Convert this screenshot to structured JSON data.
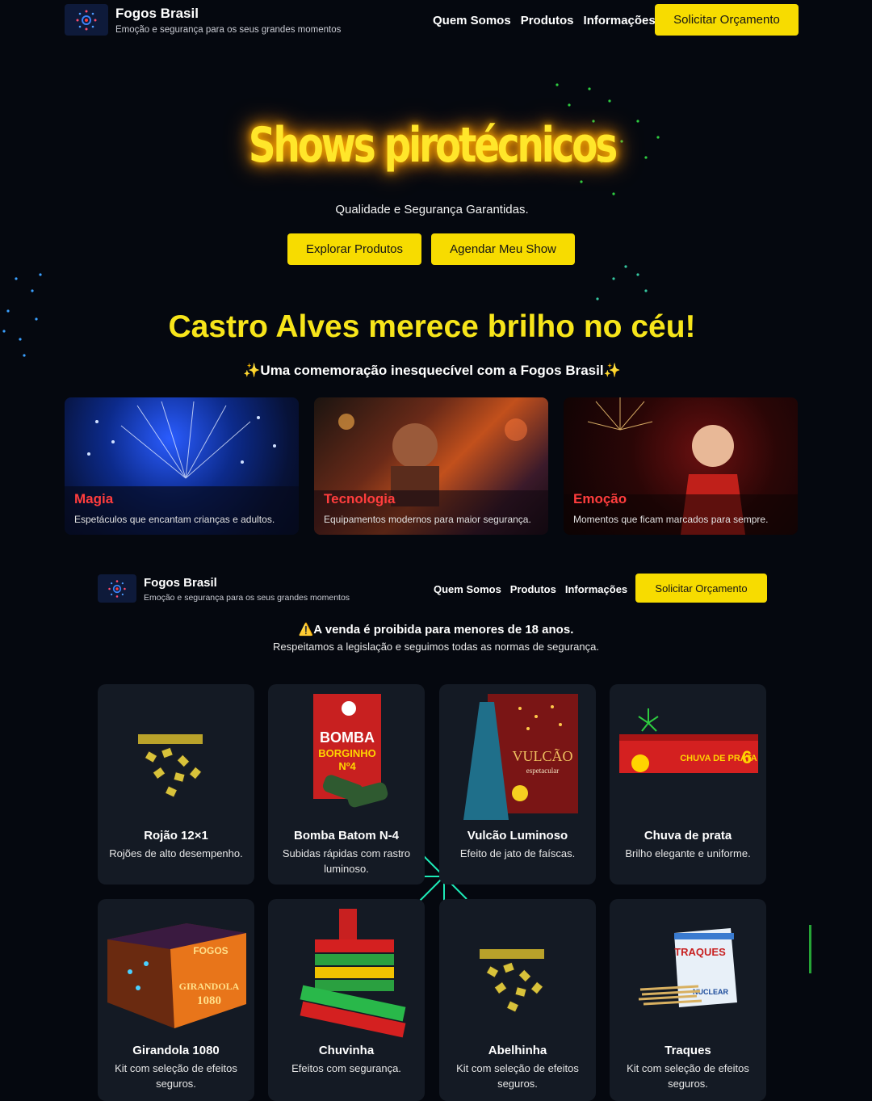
{
  "brand": {
    "name": "Fogos Brasil",
    "tagline": "Emoção e segurança para os seus grandes momentos"
  },
  "nav": {
    "items": [
      "Quem Somos",
      "Produtos",
      "Informações"
    ],
    "cta": "Solicitar Orçamento"
  },
  "hero": {
    "title": "Shows pirotécnicos",
    "subtitle": "Qualidade e Segurança Garantidas.",
    "buttons": [
      "Explorar Produtos",
      "Agendar Meu Show"
    ]
  },
  "city": {
    "title": "Castro Alves merece brilho no céu!",
    "subtitle": "✨Uma comemoração inesquecível com a Fogos Brasil✨"
  },
  "features": [
    {
      "title": "Magia",
      "description": "Espetáculos que encantam crianças e adultos."
    },
    {
      "title": "Tecnologia",
      "description": "Equipamentos modernos para maior segurança."
    },
    {
      "title": "Emoção",
      "description": "Momentos que ficam marcados para sempre."
    }
  ],
  "warning": {
    "title": "⚠️A venda é proibida para menores de 18 anos.",
    "subtitle": "Respeitamos a legislação e seguimos todas as normas de segurança."
  },
  "products": [
    {
      "name": "Rojão 12×1",
      "description": "Rojões de alto desempenho."
    },
    {
      "name": "Bomba Batom N-4",
      "description": "Subidas rápidas com rastro luminoso.",
      "image_text": [
        "BOMBA",
        "BORGINHO",
        "Nº4"
      ]
    },
    {
      "name": "Vulcão Luminoso",
      "description": "Efeito de jato de faíscas.",
      "image_text": [
        "VULCÃO",
        "espetacular"
      ]
    },
    {
      "name": "Chuva de prata",
      "description": "Brilho elegante e uniforme.",
      "image_text": [
        "CHUVA DE PRATA",
        "6"
      ]
    },
    {
      "name": "Girandola 1080",
      "description": "Kit com seleção de efeitos seguros.",
      "image_text": [
        "FOGOS",
        "GIRANDOLA",
        "1080"
      ]
    },
    {
      "name": "Chuvinha",
      "description": "Efeitos com segurança."
    },
    {
      "name": "Abelhinha",
      "description": "Kit com seleção de efeitos seguros."
    },
    {
      "name": "Traques",
      "description": "Kit com seleção de efeitos seguros.",
      "image_text": [
        "TRAQUES",
        "NUCLEAR"
      ]
    }
  ],
  "colors": {
    "background": "#05080f",
    "accent": "#f7dc00",
    "card": "#141a24",
    "feature_title": "#ff3d3d"
  }
}
